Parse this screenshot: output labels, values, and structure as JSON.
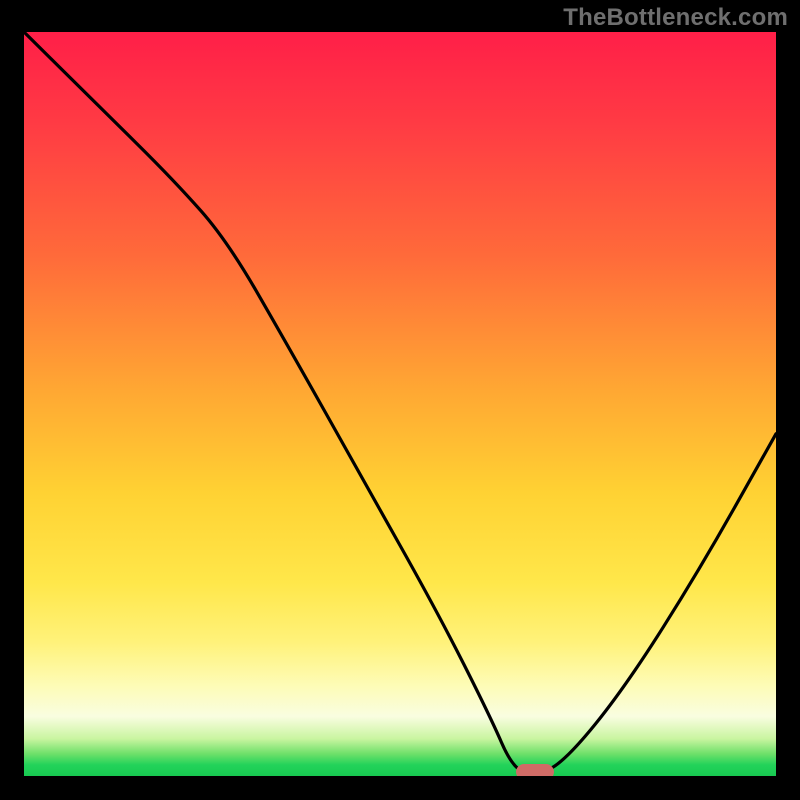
{
  "watermark": "TheBottleneck.com",
  "colors": {
    "frame_bg": "#000000",
    "curve_stroke": "#000000",
    "marker_fill": "#cf6b66",
    "gradient_top": "#ff1f48",
    "gradient_bottom": "#18c951"
  },
  "chart_data": {
    "type": "line",
    "title": "",
    "xlabel": "",
    "ylabel": "",
    "xlim": [
      0,
      100
    ],
    "ylim": [
      0,
      100
    ],
    "note": "Axis values estimated from position only (no tick labels visible). Y≈100 at top, Y≈0 at bottom; curve descends from top-left, reaches ≈0 near x≈67, then rises toward the right.",
    "series": [
      {
        "name": "bottleneck-curve",
        "x": [
          0,
          10,
          20,
          27,
          35,
          45,
          55,
          62,
          65,
          68,
          72,
          80,
          90,
          100
        ],
        "y": [
          100,
          90,
          80,
          72,
          58,
          40,
          22,
          8,
          1,
          0,
          2,
          12,
          28,
          46
        ]
      }
    ],
    "marker": {
      "name": "optimal-point",
      "x": 68,
      "y": 0,
      "shape": "rounded-rect",
      "color": "#cf6b66"
    }
  }
}
